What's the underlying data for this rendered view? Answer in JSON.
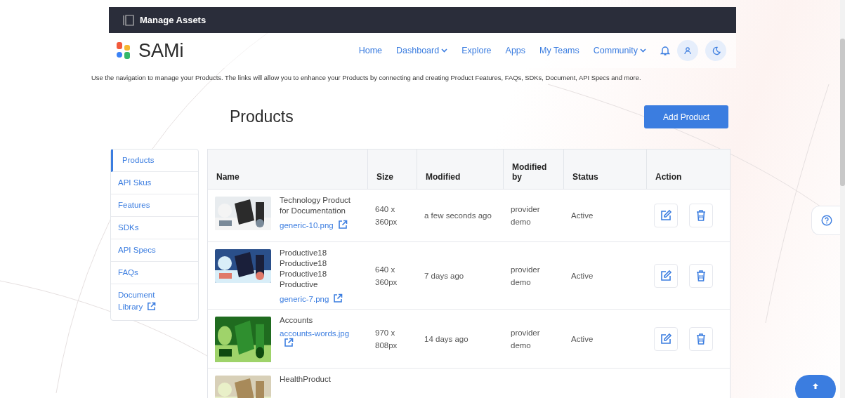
{
  "topbar": {
    "title": "Manage Assets"
  },
  "brand": {
    "name": "SAMi"
  },
  "nav": [
    {
      "label": "Home",
      "dropdown": false
    },
    {
      "label": "Dashboard",
      "dropdown": true
    },
    {
      "label": "Explore",
      "dropdown": false
    },
    {
      "label": "Apps",
      "dropdown": false
    },
    {
      "label": "My Teams",
      "dropdown": false
    },
    {
      "label": "Community",
      "dropdown": true
    }
  ],
  "intro": "Use the navigation to manage your Products. The links will allow you to enhance your Products by connecting and creating Product Features, FAQs, SDKs, Document, API Specs and more.",
  "page_title": "Products",
  "add_button": "Add Product",
  "sidebar": {
    "items": [
      {
        "label": "Products",
        "selected": true,
        "external": false
      },
      {
        "label": "API Skus",
        "selected": false,
        "external": false
      },
      {
        "label": "Features",
        "selected": false,
        "external": false
      },
      {
        "label": "SDKs",
        "selected": false,
        "external": false
      },
      {
        "label": "API Specs",
        "selected": false,
        "external": false
      },
      {
        "label": "FAQs",
        "selected": false,
        "external": false
      },
      {
        "label": "Document Library",
        "selected": false,
        "external": true
      }
    ]
  },
  "table": {
    "columns": [
      "Name",
      "Size",
      "Modified",
      "Modified by",
      "Status",
      "Action"
    ],
    "rows": [
      {
        "name": "Technology Product for Documentation",
        "file": "generic-10.png",
        "size": "640 x 360px",
        "modified": "a few seconds ago",
        "modified_by": "provider demo",
        "status": "Active"
      },
      {
        "name": "Productive18 Productive18 Productive18 Productive",
        "file": "generic-7.png",
        "size": "640 x 360px",
        "modified": "7 days ago",
        "modified_by": "provider demo",
        "status": "Active"
      },
      {
        "name": "Accounts",
        "file": "accounts-words.jpg",
        "size": "970 x 808px",
        "modified": "14 days ago",
        "modified_by": "provider demo",
        "status": "Active"
      },
      {
        "name": "HealthProduct"
      }
    ]
  }
}
